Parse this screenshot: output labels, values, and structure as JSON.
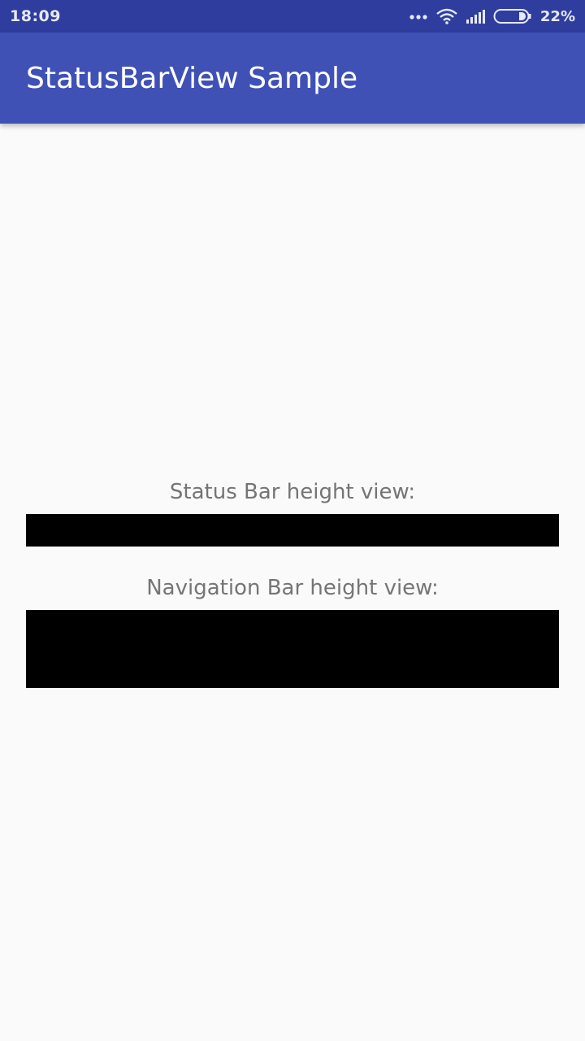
{
  "status_bar": {
    "time": "18:09",
    "battery_percent": "22%",
    "icons": [
      "more-dots-icon",
      "wifi-icon",
      "signal-icon",
      "battery-icon"
    ],
    "color": "#2f3e9e"
  },
  "app_bar": {
    "title": "StatusBarView Sample",
    "color": "#3f51b5"
  },
  "content": {
    "status_bar_label": "Status Bar height view:",
    "navigation_bar_label": "Navigation Bar height view:",
    "view_color": "#000000"
  }
}
